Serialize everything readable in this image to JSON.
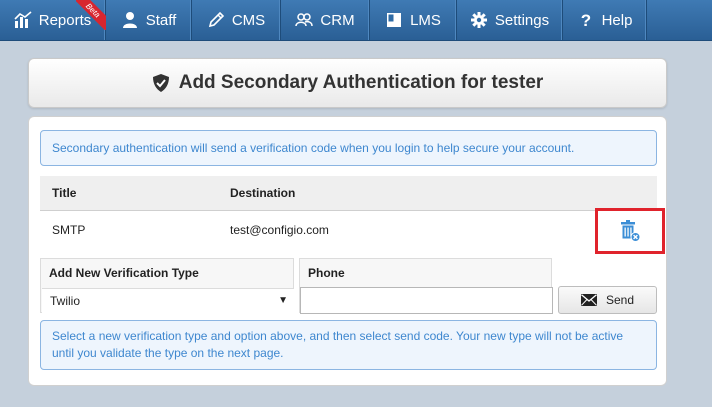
{
  "nav": {
    "items": [
      {
        "label": "Reports",
        "icon": "bar-chart-icon",
        "badge": "Beta"
      },
      {
        "label": "Staff",
        "icon": "user-icon"
      },
      {
        "label": "CMS",
        "icon": "pencil-icon"
      },
      {
        "label": "CRM",
        "icon": "users-icon"
      },
      {
        "label": "LMS",
        "icon": "book-icon"
      },
      {
        "label": "Settings",
        "icon": "gear-icon"
      },
      {
        "label": "Help",
        "icon": "question-icon"
      }
    ]
  },
  "header": {
    "title": "Add Secondary Authentication for tester",
    "icon": "shield-check-icon"
  },
  "info": {
    "top": "Secondary authentication will send a verification code when you login to help secure your account.",
    "bottom": "Select a new verification type and option above, and then select send code. Your new type will not be active until you validate the type on the next page."
  },
  "table": {
    "headers": {
      "title": "Title",
      "destination": "Destination"
    },
    "rows": [
      {
        "title": "SMTP",
        "destination": "test@configio.com"
      }
    ]
  },
  "form": {
    "type_label": "Add New Verification Type",
    "type_value": "Twilio",
    "phone_label": "Phone",
    "phone_value": "",
    "send_label": "Send"
  },
  "colors": {
    "nav_bg": "#2f6ba5",
    "info_text": "#3e87cf",
    "highlight": "#e0232c",
    "trash_icon": "#3b8ed6"
  }
}
